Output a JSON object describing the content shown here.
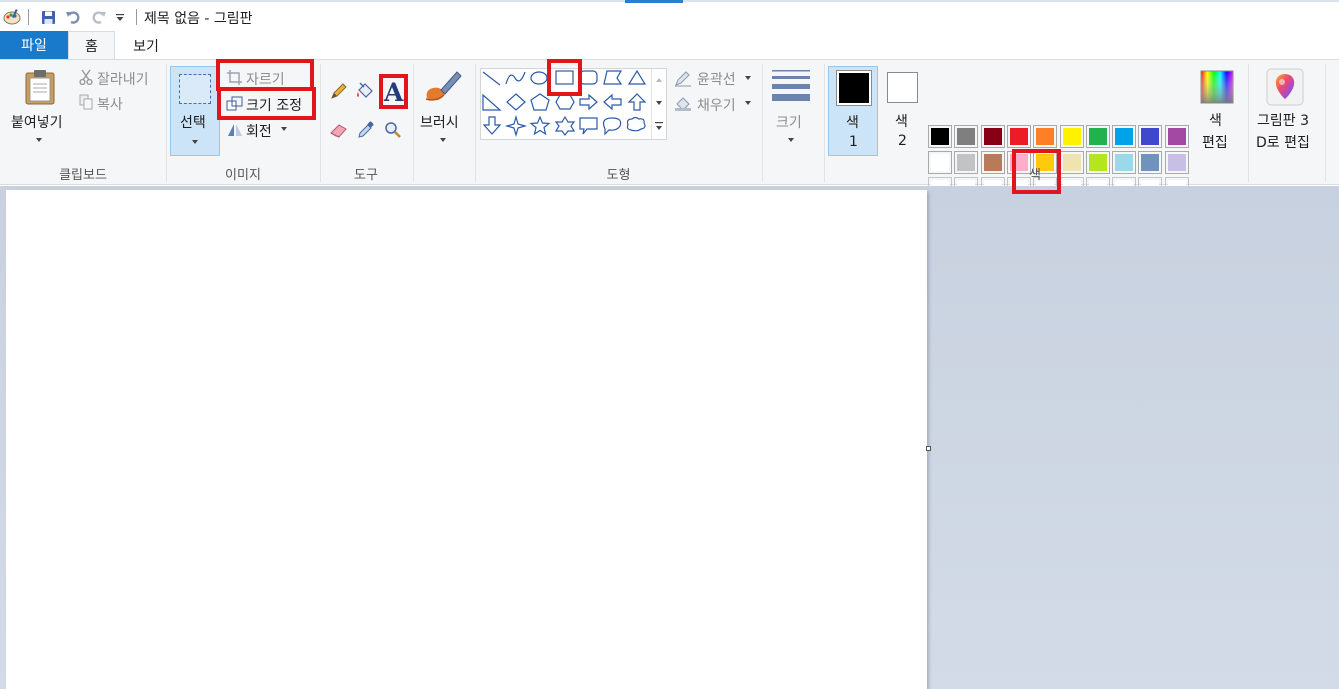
{
  "window": {
    "title": "제목 없음 - 그림판"
  },
  "tabs": {
    "file": "파일",
    "home": "홈",
    "view": "보기"
  },
  "clipboard": {
    "paste": "붙여넣기",
    "cut": "잘라내기",
    "copy": "복사",
    "label": "클립보드"
  },
  "image": {
    "select": "선택",
    "crop": "자르기",
    "resize": "크기 조정",
    "rotate": "회전",
    "label": "이미지"
  },
  "tools": {
    "label": "도구"
  },
  "brushes": {
    "label": "브러시"
  },
  "shapes": {
    "outline": "윤곽선",
    "fill": "채우기",
    "label": "도형"
  },
  "size": {
    "label": "크기"
  },
  "colors": {
    "color1_label": "색",
    "color1_num": "1",
    "color2_label": "색",
    "color2_num": "2",
    "edit_line1": "색",
    "edit_line2": "편집",
    "label": "색",
    "color1_value": "#000000",
    "color2_value": "#ffffff",
    "palette_row1": [
      "#000000",
      "#7f7f7f",
      "#880015",
      "#ed1c24",
      "#ff7f27",
      "#fff200",
      "#22b14c",
      "#00a2e8",
      "#3f48cc",
      "#a349a4"
    ],
    "palette_row2": [
      "#ffffff",
      "#c3c3c3",
      "#b97a57",
      "#ffaec9",
      "#ffc90e",
      "#efe4b0",
      "#b5e61d",
      "#99d9ea",
      "#7092be",
      "#c8bfe7"
    ],
    "palette_row3": [
      "#ffffff",
      "#ffffff",
      "#ffffff",
      "#ffffff",
      "#ffffff",
      "#ffffff",
      "#ffffff",
      "#ffffff",
      "#ffffff",
      "#ffffff"
    ]
  },
  "paint3d": {
    "line1": "그림판 3",
    "line2": "D로 편집"
  },
  "theme": {
    "accent": "#1979ca",
    "highlight": "#e0161c"
  }
}
